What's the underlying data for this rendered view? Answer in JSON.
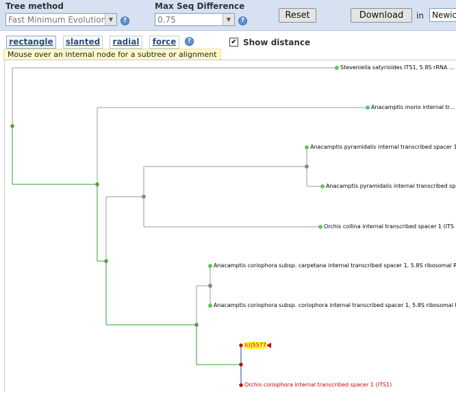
{
  "controls": {
    "tree_method_label": "Tree method",
    "tree_method_value": "Fast Minimum Evolution",
    "max_seq_label": "Max Seq Difference",
    "max_seq_value": "0.75",
    "reset_label": "Reset",
    "download_label": "Download",
    "in_label": "in",
    "format_value": "Newic"
  },
  "layout_tabs": [
    {
      "label": "rectangle"
    },
    {
      "label": "slanted"
    },
    {
      "label": "radial"
    },
    {
      "label": "force"
    }
  ],
  "show_distance": {
    "label": "Show distance",
    "checked": true
  },
  "hint": "Mouse over an internal node for a subtree or alignment",
  "tree": {
    "leaves": [
      {
        "label": "Steveniella satyrioides ITS1, 5.8S rRNA ..."
      },
      {
        "label": "Anacamptis morio internal tr..."
      },
      {
        "label": "Anacamptis pyramidalis internal transcribed spacer 1,"
      },
      {
        "label": "Anacamptis pyramidalis internal transcribed sp..."
      },
      {
        "label": "Orchis collina internal transcribed spacer 1 (ITS"
      },
      {
        "label": "Anacamptis coriophora subsp. carpetana internal transcribed spacer 1, 5.8S ribosomal R..."
      },
      {
        "label": "Anacamptis coriophora subsp. coriophora internal transcribed spacer 1, 5.8S ribosomal R..."
      },
      {
        "label": "lcl|5577"
      },
      {
        "label": "Orchis coriophora internal transcribed spacer 1 (ITS1)"
      }
    ],
    "colors": {
      "path": "#2ca02c",
      "branch": "#999999",
      "query": "#cc0000",
      "query_branch": "#1f3ea8",
      "leaf_node": "#44dd44",
      "internal_node": "#888888",
      "path_node": "#55aa33"
    }
  }
}
